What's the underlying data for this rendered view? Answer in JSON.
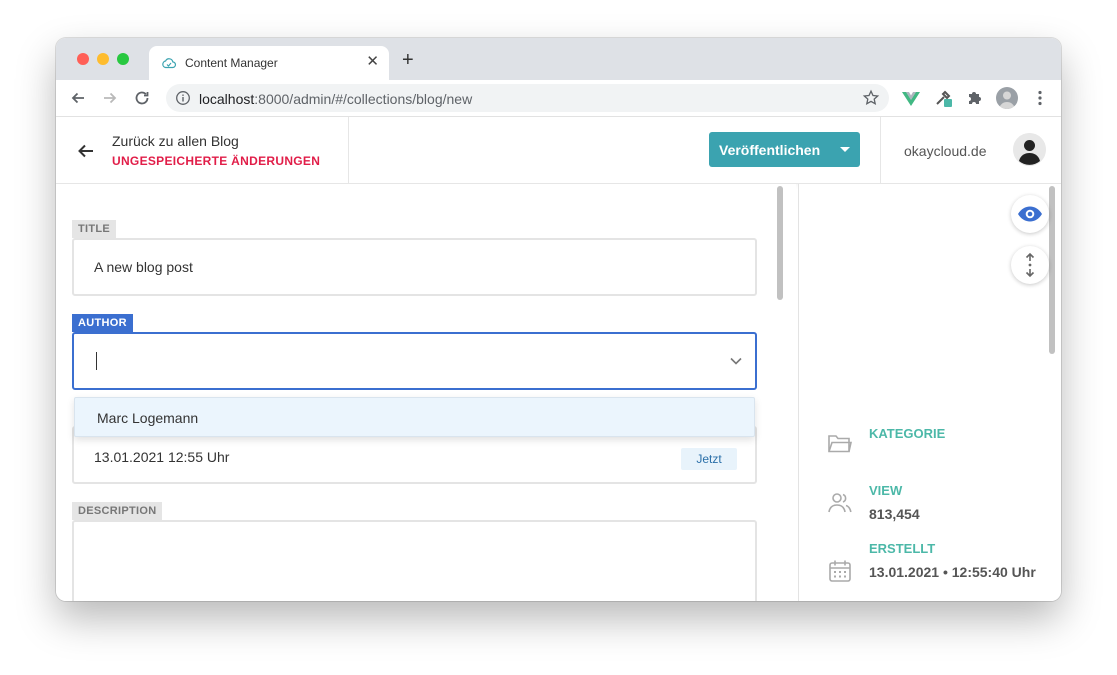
{
  "browser": {
    "tab_title": "Content Manager",
    "url_host": "localhost",
    "url_rest": ":8000/admin/#/collections/blog/new"
  },
  "header": {
    "back_label": "Zurück zu allen Blog",
    "unsaved_label": "UNGESPEICHERTE ÄNDERUNGEN",
    "publish_label": "Veröffentlichen",
    "site_name": "okaycloud.de"
  },
  "form": {
    "title_label": "TITLE",
    "title_value": "A new blog post",
    "author_label": "AUTHOR",
    "author_value": "",
    "author_options": [
      "Marc Logemann"
    ],
    "date_value": "13.01.2021 12:55 Uhr",
    "date_now_label": "Jetzt",
    "description_label": "DESCRIPTION",
    "description_value": ""
  },
  "meta": {
    "category_label": "KATEGORIE",
    "view_label": "VIEW",
    "view_value": "813,454",
    "created_label": "ERSTELLT",
    "created_value": "13.01.2021 • 12:55:40 Uhr"
  },
  "colors": {
    "accent": "#3ba3b0",
    "focus": "#3b6fd0",
    "unsaved": "#e11d48",
    "meta_label": "#4cb8a8"
  }
}
